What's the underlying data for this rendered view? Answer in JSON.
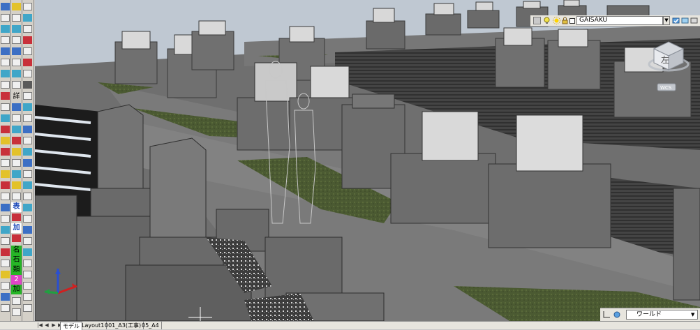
{
  "toolbars": {
    "left_labels": [
      "詳",
      "表",
      "加",
      "名",
      "石",
      "類",
      "2",
      "加"
    ]
  },
  "layer_control": {
    "current_layer": "GAISAKU"
  },
  "viewcube": {
    "face_label": "左",
    "coord_system": "WCS"
  },
  "ucs_control": {
    "current": "ワールド"
  },
  "layout_tabs": [
    {
      "label": "モデル",
      "active": true
    },
    {
      "label": "Layout1",
      "active": false
    },
    {
      "label": "001_A3(工事)",
      "active": false
    },
    {
      "label": "05_A4",
      "active": false
    }
  ],
  "colors": {
    "sky": "#bfc8d2",
    "ground": "#686868",
    "stone": "#6b6b6b",
    "lawn": "#4b5a32",
    "gravel": "#1c1c1c",
    "toolbar": "#d4d0c8"
  }
}
